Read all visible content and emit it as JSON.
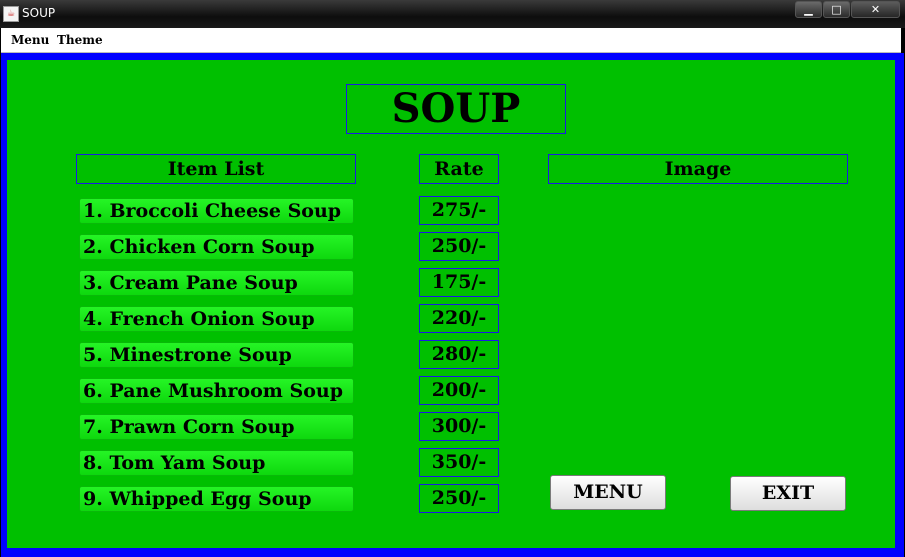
{
  "window": {
    "title": "SOUP"
  },
  "menubar": {
    "items": [
      "Menu",
      "Theme"
    ]
  },
  "page": {
    "title": "SOUP"
  },
  "headers": {
    "items": "Item List",
    "rate": "Rate",
    "image": "Image"
  },
  "soups": [
    {
      "name": "1. Broccoli Cheese Soup",
      "rate": "275/-"
    },
    {
      "name": "2. Chicken Corn Soup",
      "rate": "250/-"
    },
    {
      "name": "3. Cream Pane Soup",
      "rate": "175/-"
    },
    {
      "name": "4. French Onion Soup",
      "rate": "220/-"
    },
    {
      "name": "5. Minestrone Soup",
      "rate": "280/-"
    },
    {
      "name": "6. Pane Mushroom Soup",
      "rate": "200/-"
    },
    {
      "name": "7. Prawn Corn Soup",
      "rate": "300/-"
    },
    {
      "name": "8. Tom Yam Soup",
      "rate": "350/-"
    },
    {
      "name": "9. Whipped Egg Soup",
      "rate": "250/-"
    }
  ],
  "buttons": {
    "menu": "MENU",
    "exit": "EXIT"
  },
  "colors": {
    "panel": "#00c000",
    "border": "#0000ff",
    "item_button": "#18e818"
  }
}
